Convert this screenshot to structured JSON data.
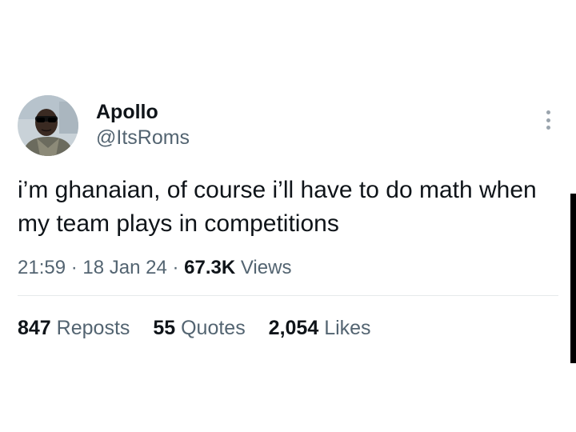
{
  "author": {
    "display_name": "Apollo",
    "handle": "@ItsRoms",
    "avatar_icon": "profile-photo"
  },
  "tweet": {
    "text": "i’m ghanaian, of course i’ll have to do math when my team plays in competitions",
    "time": "21:59",
    "date": "18 Jan 24",
    "separator": " · ",
    "views_count": "67.3K",
    "views_label": "Views"
  },
  "stats": {
    "reposts_count": "847",
    "reposts_label": "Reposts",
    "quotes_count": "55",
    "quotes_label": "Quotes",
    "likes_count": "2,054",
    "likes_label": "Likes"
  },
  "colors": {
    "primary_text": "#0f1419",
    "secondary_text": "#536471",
    "divider": "#e6e9eb",
    "more_dots": "#9aa4ad"
  }
}
